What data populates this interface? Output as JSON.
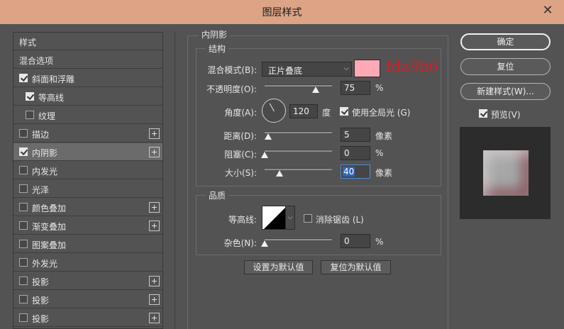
{
  "window": {
    "title": "图层样式"
  },
  "colors": {
    "shadow_color": "#fda9b6"
  },
  "style_list": {
    "header": "样式",
    "blend_options": "混合选项",
    "items": [
      {
        "label": "斜面和浮雕",
        "checked": true
      },
      {
        "label": "等高线",
        "checked": true
      },
      {
        "label": "纹理",
        "checked": false
      },
      {
        "label": "描边",
        "checked": false,
        "plus": true
      },
      {
        "label": "内阴影",
        "checked": true,
        "plus": true,
        "selected": true
      },
      {
        "label": "内发光",
        "checked": false
      },
      {
        "label": "光泽",
        "checked": false
      },
      {
        "label": "颜色叠加",
        "checked": false,
        "plus": true
      },
      {
        "label": "渐变叠加",
        "checked": false,
        "plus": true
      },
      {
        "label": "图案叠加",
        "checked": false
      },
      {
        "label": "外发光",
        "checked": false
      },
      {
        "label": "投影",
        "checked": false,
        "plus": true
      },
      {
        "label": "投影",
        "checked": false,
        "plus": true
      },
      {
        "label": "投影",
        "checked": false,
        "plus": true
      }
    ]
  },
  "inner_shadow": {
    "section_title": "内阴影",
    "structure_title": "结构",
    "blend_mode_label": "混合模式(B):",
    "blend_mode_value": "正片叠底",
    "color_annotation": "fda9b6",
    "opacity_label": "不透明度(O):",
    "opacity_value": "75",
    "opacity_unit": "%",
    "opacity_level": 0.75,
    "angle_label": "角度(A):",
    "angle_value": "120",
    "angle_unit": "度",
    "global_light_label": "使用全局光 (G)",
    "global_light_checked": true,
    "distance_label": "距离(D):",
    "distance_value": "5",
    "distance_unit": "像素",
    "choke_label": "阻塞(C):",
    "choke_value": "0",
    "choke_unit": "%",
    "size_label": "大小(S):",
    "size_value": "40",
    "size_unit": "像素",
    "quality_title": "品质",
    "contour_label": "等高线:",
    "anti_alias_label": "消除锯齿 (L)",
    "anti_alias_checked": false,
    "noise_label": "杂色(N):",
    "noise_value": "0",
    "noise_unit": "%",
    "make_default_label": "设置为默认值",
    "reset_default_label": "复位为默认值"
  },
  "actions": {
    "ok_label": "确定",
    "reset_label": "复位",
    "new_style_label": "新建样式(W)...",
    "preview_label": "预览(V)",
    "preview_checked": true
  }
}
